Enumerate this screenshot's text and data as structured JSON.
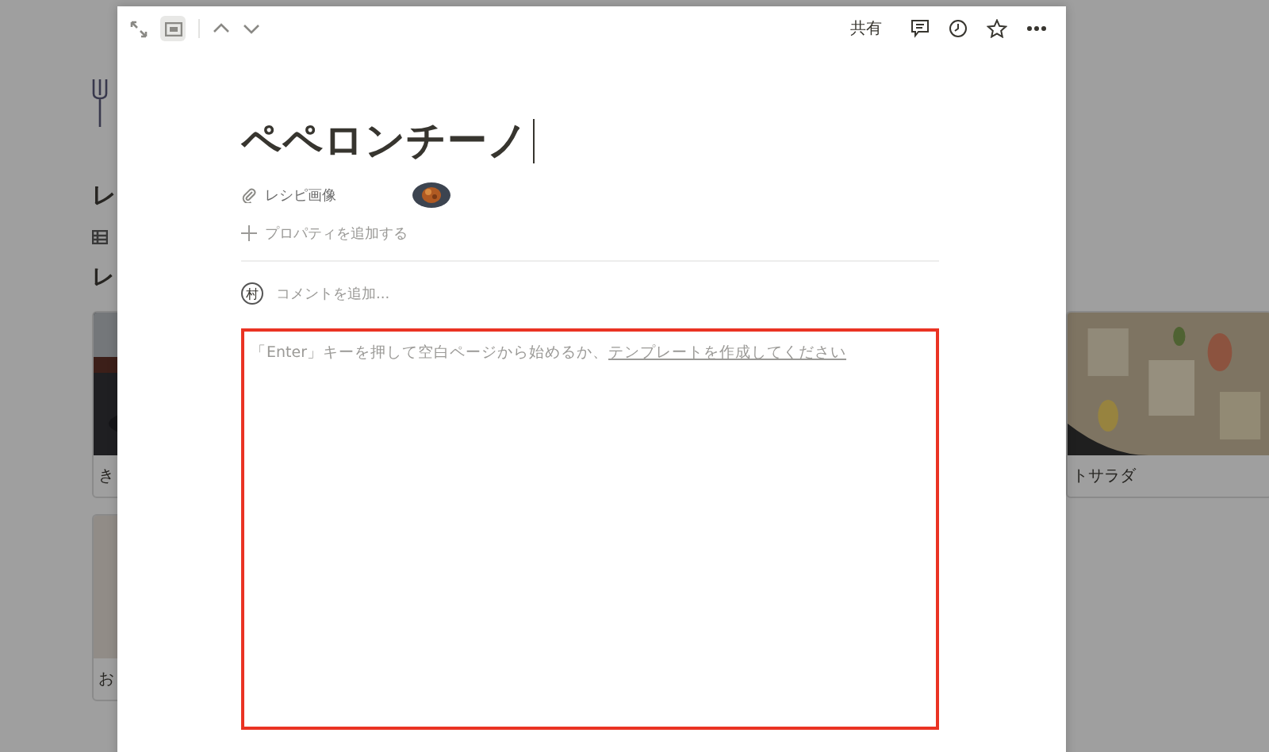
{
  "background": {
    "title": "レ",
    "section_title": "レ",
    "left_cards": [
      {
        "caption": "き"
      },
      {
        "caption": "お"
      }
    ],
    "right_cards": [
      {
        "caption": "トサラダ"
      }
    ]
  },
  "peek": {
    "toolbar": {
      "view_selected": true,
      "share": "共有"
    },
    "title": "ペペロンチーノ",
    "properties": [
      {
        "label": "レシピ画像"
      }
    ],
    "add_property": "プロパティを追加する",
    "comment": {
      "avatar": "村",
      "placeholder": "コメントを追加..."
    },
    "body": {
      "highlighted": true,
      "hint": "「Enter」キーを押して空白ページから始めるか、",
      "link": "テンプレートを作成してください"
    }
  }
}
